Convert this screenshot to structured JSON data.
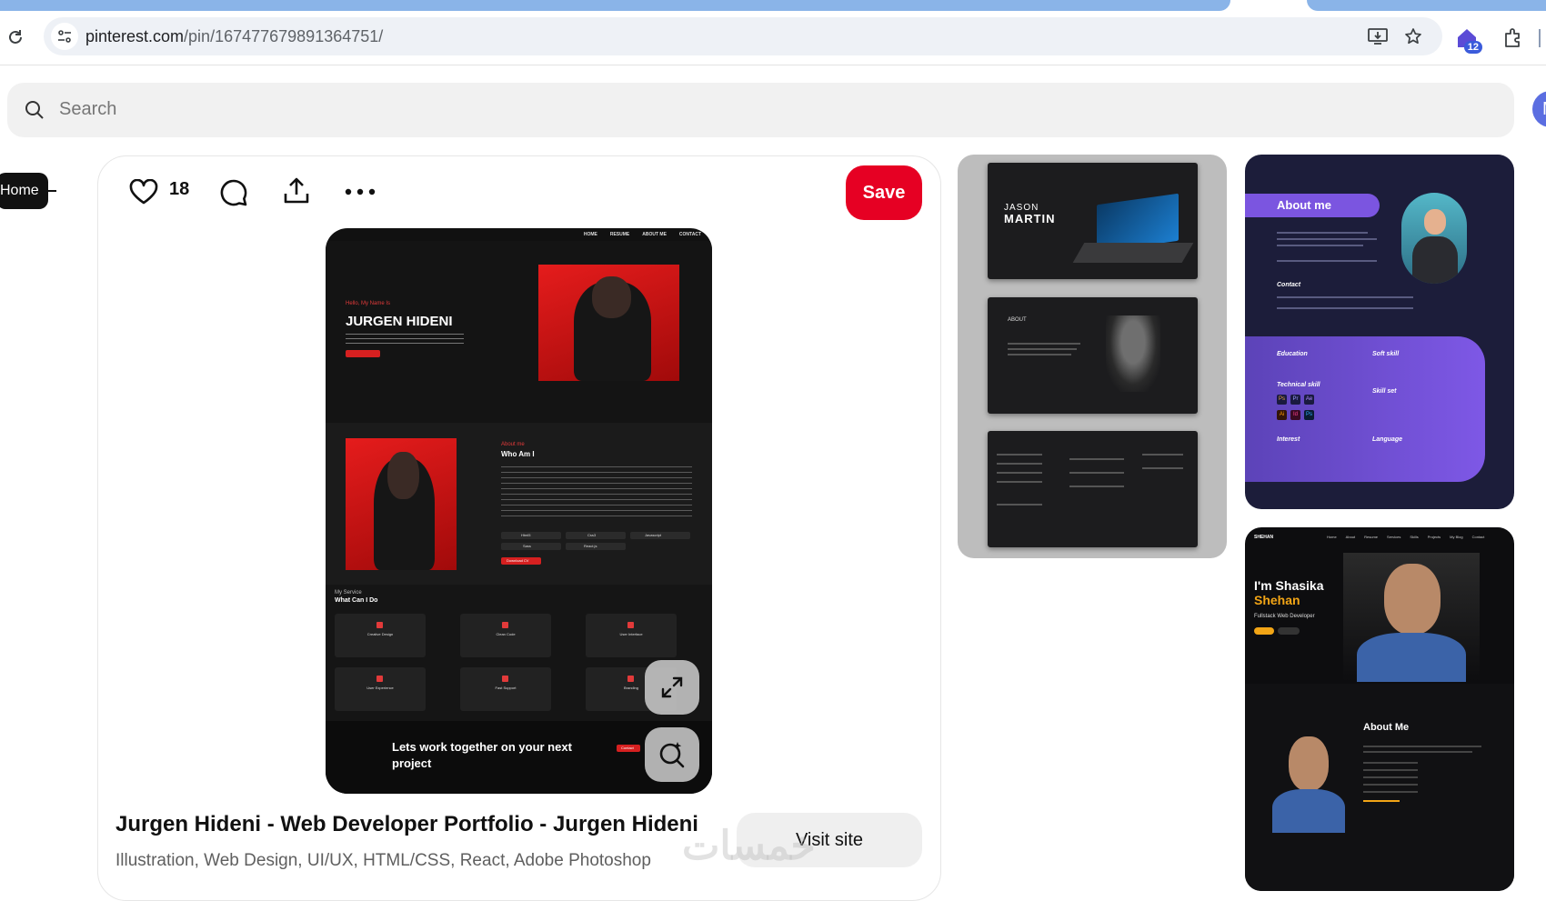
{
  "browser": {
    "url_domain": "pinterest.com",
    "url_path": "/pin/167477679891364751/",
    "extensions_count": "12"
  },
  "search": {
    "placeholder": "Search"
  },
  "user": {
    "avatar_initial": "M"
  },
  "sidebar": {
    "home_tooltip": "Home"
  },
  "pin": {
    "likes": "18",
    "save_label": "Save",
    "title": "Jurgen Hideni - Web Developer Portfolio - Jurgen Hideni",
    "tags": "Illustration, Web Design, UI/UX, HTML/CSS, React, Adobe Photoshop",
    "visit_label": "Visit site",
    "watermark": "خمسات",
    "image": {
      "nav": [
        "HOME",
        "RESUME",
        "ABOUT ME",
        "CONTACT"
      ],
      "hello": "Hello, My Name Is",
      "name": "JURGEN HIDENI",
      "about_kicker": "About me",
      "about_title": "Who Am I",
      "skills": [
        "Html5",
        "Css3",
        "Javascript",
        "Sass",
        "React.js"
      ],
      "download_cv": "Download CV",
      "services_kicker": "My Service",
      "services_title": "What Can I Do",
      "services": [
        "Creative Design",
        "Clean Code",
        "User Interface",
        "User Experience",
        "Fast Support",
        "Branding"
      ],
      "cta": "Lets work together on your next project",
      "contact": "Contact"
    }
  },
  "related": {
    "pin1": {
      "first_name": "JASON",
      "last_name": "MARTIN",
      "about": "ABOUT"
    },
    "pin2": {
      "about": "About me",
      "contact": "Contact",
      "education": "Education",
      "soft_skill": "Soft skill",
      "technical_skill": "Technical skill",
      "skill_set": "Skill set",
      "interest": "Interest",
      "language": "Language",
      "tools": [
        "Ps",
        "Pr",
        "Ae",
        "Ai",
        "Id",
        "Ps"
      ]
    },
    "pin3": {
      "logo": "SHEHAN",
      "nav": [
        "Home",
        "About",
        "Resume",
        "Services",
        "Skills",
        "Projects",
        "My Blog",
        "Contact"
      ],
      "hello": "I'm Shasika",
      "name": "Shehan",
      "role": "Fullstack Web Developer",
      "about_title": "About Me"
    }
  }
}
